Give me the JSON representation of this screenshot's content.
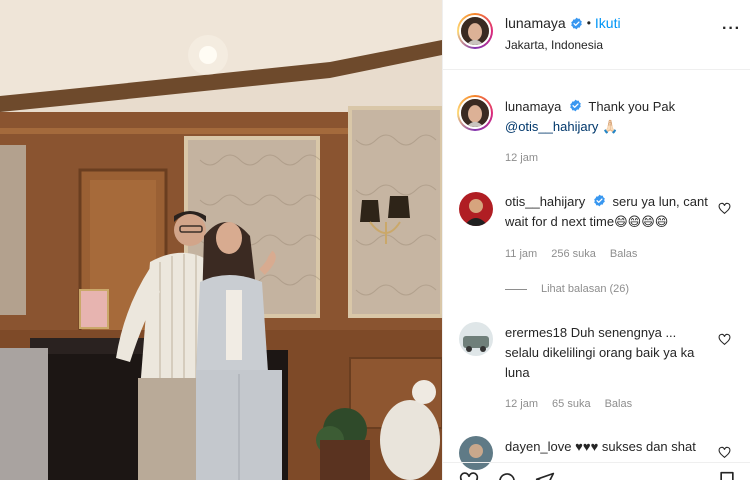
{
  "header": {
    "username": "lunamaya",
    "separator": "•",
    "follow_label": "Ikuti",
    "location": "Jakarta, Indonesia",
    "more_label": "···"
  },
  "caption": {
    "username": "lunamaya",
    "text": "Thank you Pak",
    "mention": "@otis__hahijary",
    "emoji": "🙏🏻",
    "time": "12 jam"
  },
  "comments": [
    {
      "username": "otis__hahijary",
      "verified": true,
      "text": "seru ya lun, cant wait for d next time😄😄😄😄",
      "time": "11 jam",
      "likes": "256 suka",
      "reply": "Balas",
      "view_replies": "Lihat balasan (26)"
    },
    {
      "username": "erermes18",
      "verified": false,
      "text": "Duh senengnya ... selalu dikelilingi orang baik ya ka luna",
      "time": "12 jam",
      "likes": "65 suka",
      "reply": "Balas"
    },
    {
      "username": "dayen_love",
      "verified": false,
      "text": "♥♥♥ sukses dan shat",
      "time": "",
      "likes": "",
      "reply": ""
    }
  ],
  "colors": {
    "accent": "#0095f6",
    "verified": "#3897f0",
    "muted": "#8e8e8e",
    "text": "#262626",
    "mention": "#00376b"
  },
  "icons": [
    "verified-badge-icon",
    "heart-icon",
    "more-icon",
    "like-icon",
    "comment-icon",
    "share-icon",
    "save-icon"
  ]
}
